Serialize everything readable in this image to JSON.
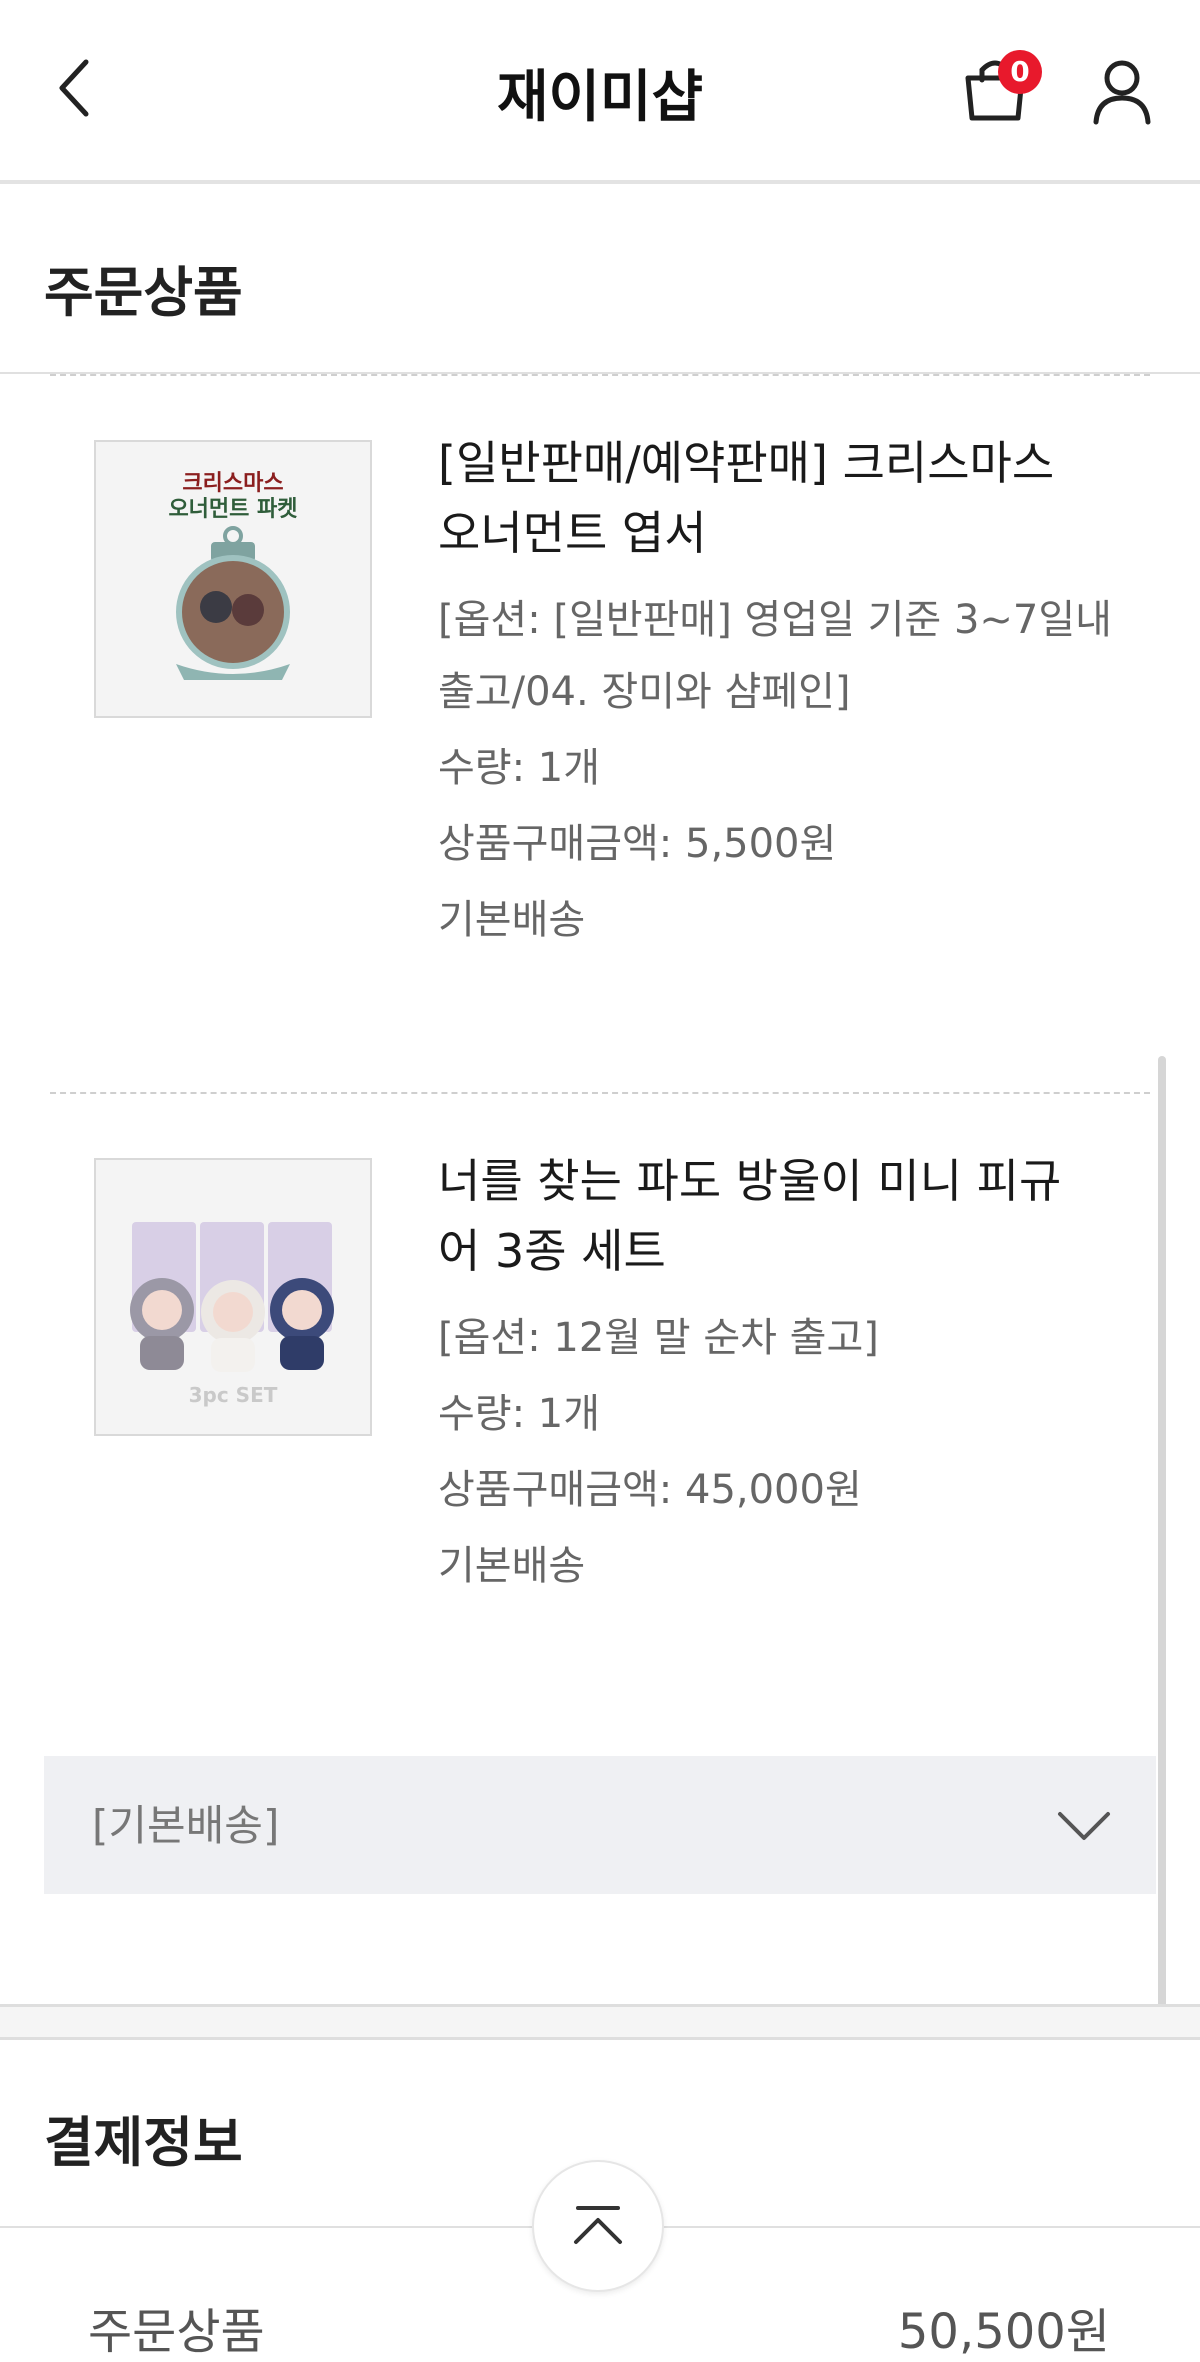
{
  "header": {
    "title": "재이미샵",
    "cart_count": "0",
    "icons": [
      "back-arrow-icon",
      "shopping-bag-icon",
      "user-icon"
    ]
  },
  "order_section": {
    "title": "주문상품",
    "items": [
      {
        "thumb_text_line1": "크리스마스",
        "thumb_text_line2": "오너먼트 파켓",
        "name_line1": "[일반판매/예약판매] 크리스마스",
        "name_line2": "오너먼트 엽서",
        "option_line1": "[옵션: [일반판매] 영업일 기준 3~7일내",
        "option_line2": "출고/04. 장미와 샴페인]",
        "quantity": "수량: 1개",
        "price": "상품구매금액: 5,500원",
        "shipping": "기본배송"
      },
      {
        "thumb_badge": "3pc SET",
        "name_line1": "너를 찾는 파도 방울이 미니 피규",
        "name_line2": "어 3종 세트",
        "option_line1": "[옵션: 12월 말 순차 출고]",
        "quantity": "수량: 1개",
        "price": "상품구매금액: 45,000원",
        "shipping": "기본배송"
      }
    ],
    "shipping_group_label": "[기본배송]"
  },
  "payment_section": {
    "title": "결제정보",
    "rows": [
      {
        "label": "주문상품",
        "value": "50,500원"
      }
    ]
  },
  "colors": {
    "badge": "#e8192c",
    "divider": "#e0e0e0",
    "shipping_box_bg": "#eff0f3",
    "secondary_text": "#666666"
  }
}
